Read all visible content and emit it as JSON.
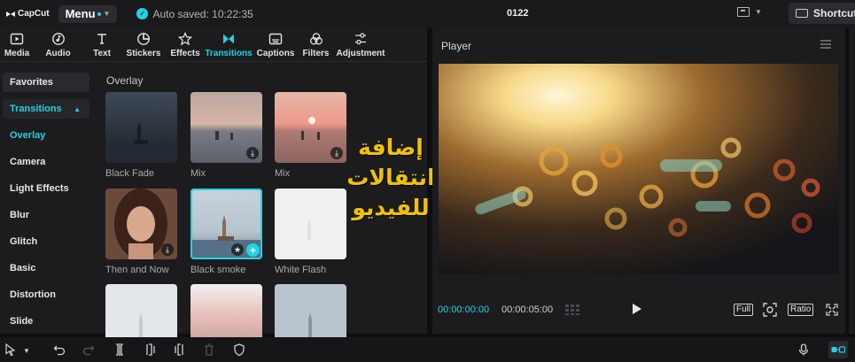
{
  "app": {
    "logo_text": "CapCut",
    "menu_label": "Menu",
    "autosave_text": "Auto saved: 10:22:35",
    "project_title": "0122",
    "shortcut_label": "Shortcut",
    "accent_color": "#1fd4e3"
  },
  "toolbar": {
    "items": [
      {
        "label": "Media",
        "icon": "media-icon"
      },
      {
        "label": "Audio",
        "icon": "audio-icon"
      },
      {
        "label": "Text",
        "icon": "text-icon"
      },
      {
        "label": "Stickers",
        "icon": "stickers-icon"
      },
      {
        "label": "Effects",
        "icon": "effects-icon"
      },
      {
        "label": "Transitions",
        "icon": "transitions-icon",
        "active": true
      },
      {
        "label": "Captions",
        "icon": "captions-icon"
      },
      {
        "label": "Filters",
        "icon": "filters-icon"
      },
      {
        "label": "Adjustment",
        "icon": "adjustment-icon"
      }
    ]
  },
  "categories": {
    "favorites": "Favorites",
    "group": "Transitions",
    "items": [
      "Overlay",
      "Camera",
      "Light Effects",
      "Blur",
      "Glitch",
      "Basic",
      "Distortion",
      "Slide"
    ],
    "selected": "Overlay"
  },
  "section_title": "Overlay",
  "transitions": [
    {
      "label": "Black Fade"
    },
    {
      "label": "Mix"
    },
    {
      "label": "Mix"
    },
    {
      "label": "Then and Now"
    },
    {
      "label": "Black smoke"
    },
    {
      "label": "White Flash"
    }
  ],
  "overlay_text": {
    "line1": "إضافة",
    "line2": "انتقالات",
    "line3": "للفيديو"
  },
  "player": {
    "title": "Player",
    "current_time": "00:00:00:00",
    "total_time": "00:00:05:00",
    "full_label": "Full",
    "ratio_label": "Ratio"
  }
}
